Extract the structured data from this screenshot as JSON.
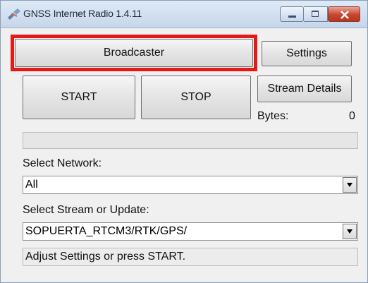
{
  "window": {
    "title": "GNSS Internet Radio 1.4.11"
  },
  "buttons": {
    "broadcaster": "Broadcaster",
    "settings": "Settings",
    "start": "START",
    "stop": "STOP",
    "stream_details": "Stream Details"
  },
  "stats": {
    "bytes_label": "Bytes:",
    "bytes_value": "0"
  },
  "network": {
    "label": "Select Network:",
    "selected": "All"
  },
  "stream": {
    "label": "Select Stream or Update:",
    "selected": "SOPUERTA_RTCM3/RTK/GPS/"
  },
  "status_text": "Adjust Settings or press START.",
  "colors": {
    "highlight": "#e61919",
    "close_button": "#c8452e"
  }
}
